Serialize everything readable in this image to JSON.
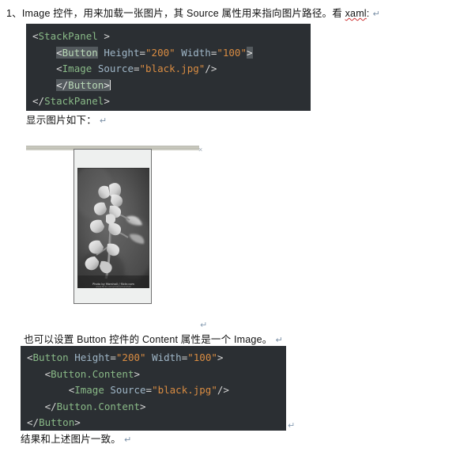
{
  "document": {
    "paragraph_1": "1、Image 控件，用来加载一张图片，其 Source 属性用来指向图片路径。看 ",
    "paragraph_1_spell_word": "xaml",
    "paragraph_1_tail": ":",
    "paragraph_2": "显示图片如下：",
    "paragraph_3": "也可以设置 Button 控件的 Content 属性是一个 Image。",
    "paragraph_4": "结果和上述图片一致。",
    "pilcrow": "↵"
  },
  "code_block_1": {
    "language": "xaml",
    "background": "#2b2f33",
    "lines": [
      {
        "indent": "",
        "tokens": [
          {
            "text": "<",
            "type": "punct"
          },
          {
            "text": "StackPanel",
            "type": "tag"
          },
          {
            "text": " >",
            "type": "punct"
          }
        ]
      },
      {
        "indent": "    ",
        "tokens": [
          {
            "text": "<",
            "type": "selpunct"
          },
          {
            "text": "Button",
            "type": "sel"
          },
          {
            "text": " ",
            "type": "punct"
          },
          {
            "text": "Height",
            "type": "attr"
          },
          {
            "text": "=",
            "type": "eq"
          },
          {
            "text": "\"200\"",
            "type": "val"
          },
          {
            "text": " ",
            "type": "punct"
          },
          {
            "text": "Width",
            "type": "attr"
          },
          {
            "text": "=",
            "type": "eq"
          },
          {
            "text": "\"100\"",
            "type": "val"
          },
          {
            "text": ">",
            "type": "selpunct"
          }
        ]
      },
      {
        "indent": "    ",
        "tokens": [
          {
            "text": "<",
            "type": "punct"
          },
          {
            "text": "Image",
            "type": "tag"
          },
          {
            "text": " ",
            "type": "punct"
          },
          {
            "text": "Source",
            "type": "attr"
          },
          {
            "text": "=",
            "type": "eq"
          },
          {
            "text": "\"black.jpg\"",
            "type": "val"
          },
          {
            "text": "/>",
            "type": "punct"
          }
        ]
      },
      {
        "indent": "    ",
        "tokens": [
          {
            "text": "</",
            "type": "selpunct"
          },
          {
            "text": "Button",
            "type": "sel"
          },
          {
            "text": ">",
            "type": "selpunct"
          },
          {
            "text": "",
            "type": "caret"
          }
        ]
      },
      {
        "indent": "",
        "tokens": [
          {
            "text": "</",
            "type": "punct"
          },
          {
            "text": "StackPanel",
            "type": "tag"
          },
          {
            "text": ">",
            "type": "punct"
          }
        ]
      }
    ]
  },
  "code_block_2": {
    "language": "xaml",
    "background": "#2b2f33",
    "lines": [
      {
        "indent": "",
        "tokens": [
          {
            "text": "<",
            "type": "punct"
          },
          {
            "text": "Button",
            "type": "tag"
          },
          {
            "text": " ",
            "type": "punct"
          },
          {
            "text": "Height",
            "type": "attr"
          },
          {
            "text": "=",
            "type": "eq"
          },
          {
            "text": "\"200\"",
            "type": "val"
          },
          {
            "text": " ",
            "type": "punct"
          },
          {
            "text": "Width",
            "type": "attr"
          },
          {
            "text": "=",
            "type": "eq"
          },
          {
            "text": "\"100\"",
            "type": "val"
          },
          {
            "text": ">",
            "type": "punct"
          }
        ]
      },
      {
        "indent": "   ",
        "tokens": [
          {
            "text": "<",
            "type": "punct"
          },
          {
            "text": "Button.Content",
            "type": "tag"
          },
          {
            "text": ">",
            "type": "punct"
          }
        ]
      },
      {
        "indent": "       ",
        "tokens": [
          {
            "text": "<",
            "type": "punct"
          },
          {
            "text": "Image",
            "type": "tag"
          },
          {
            "text": " ",
            "type": "punct"
          },
          {
            "text": "Source",
            "type": "attr"
          },
          {
            "text": "=",
            "type": "eq"
          },
          {
            "text": "\"black.jpg\"",
            "type": "val"
          },
          {
            "text": "/>",
            "type": "punct"
          }
        ]
      },
      {
        "indent": "   ",
        "tokens": [
          {
            "text": "</",
            "type": "punct"
          },
          {
            "text": "Button.Content",
            "type": "tag"
          },
          {
            "text": ">",
            "type": "punct"
          }
        ]
      },
      {
        "indent": "",
        "tokens": [
          {
            "text": "</",
            "type": "punct"
          },
          {
            "text": "Button",
            "type": "tag"
          },
          {
            "text": ">",
            "type": "punct"
          }
        ]
      }
    ]
  },
  "preview": {
    "button": {
      "height": "200",
      "width": "100",
      "background": "#eef0ef",
      "border_color": "#707070"
    },
    "image": {
      "source": "black.jpg",
      "description": "grayscale macro photograph of a flower cluster",
      "watermark": "Photo by Marshall / flickr.com",
      "watermark_secondary": "www.flickr.com/photos/marshall"
    }
  },
  "colors": {
    "code_background": "#2b2f33",
    "tag": "#89b987",
    "attribute": "#9fb6c7",
    "value": "#d98c42",
    "punctuation": "#d6d6d6",
    "selection": "#545a5e",
    "page_background": "#ffffff"
  }
}
